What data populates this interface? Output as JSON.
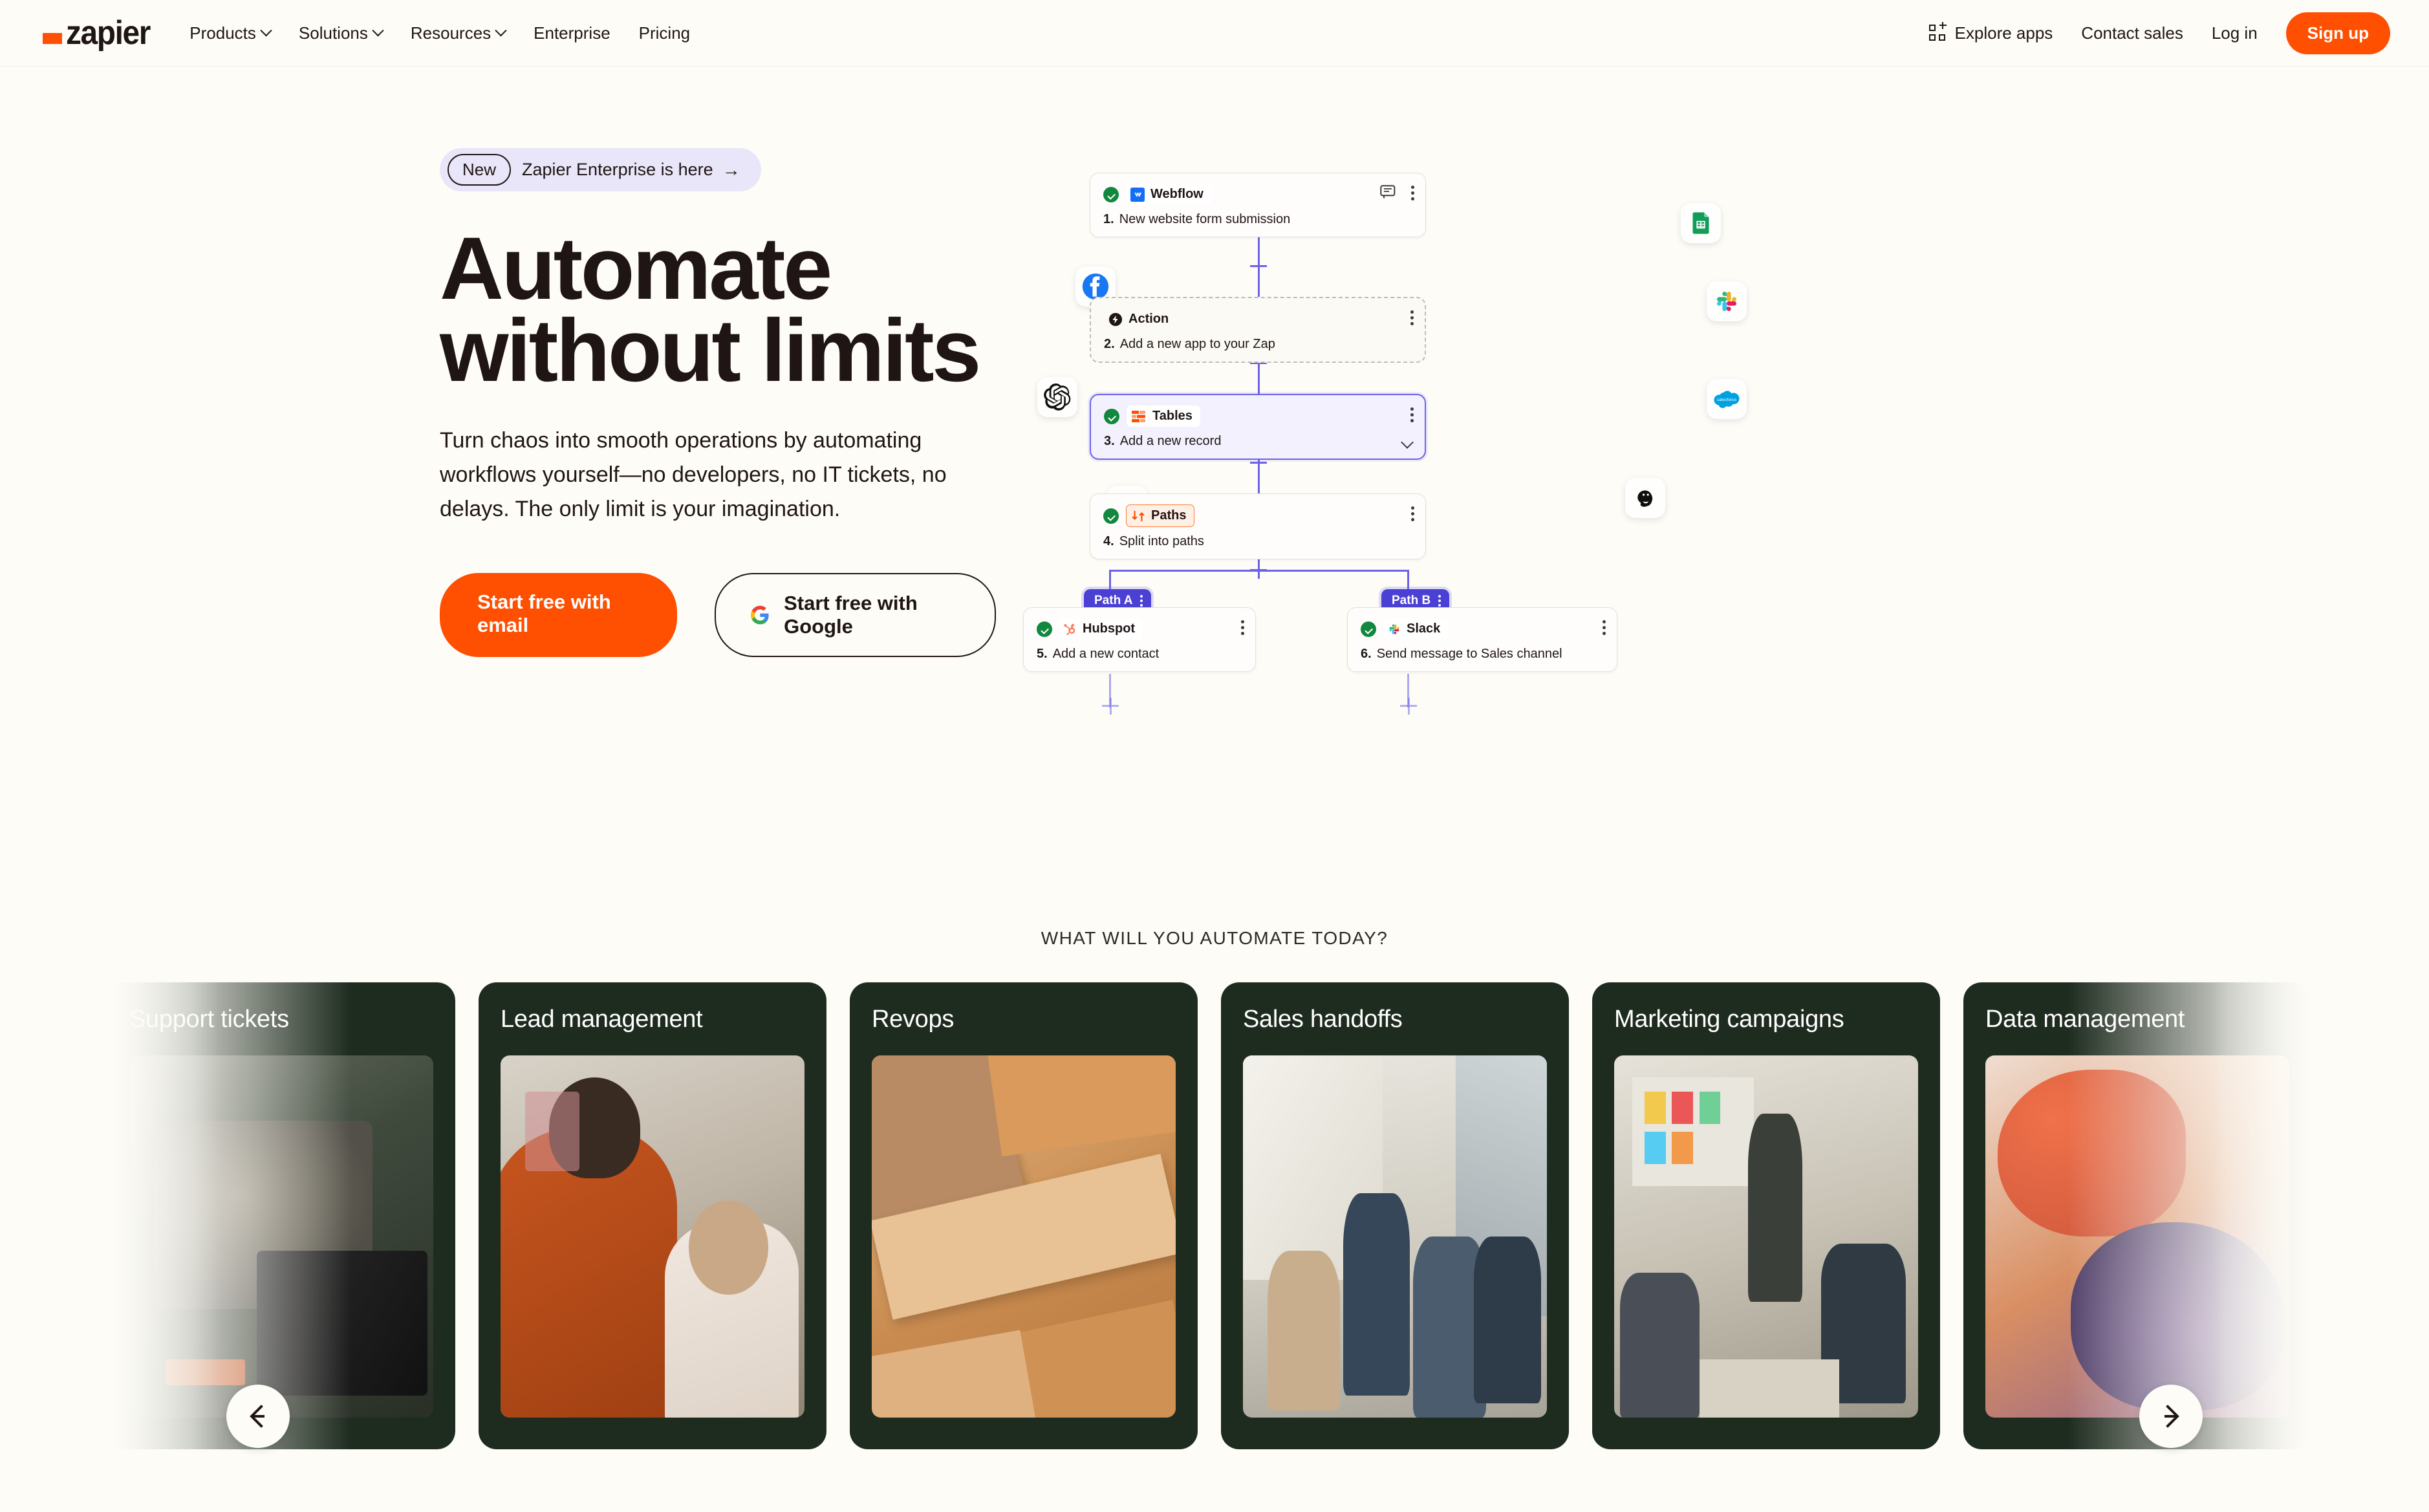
{
  "brand": {
    "name": "zapier",
    "accent": "#FF4F00",
    "background": "#FDFCF7"
  },
  "header": {
    "nav_left": [
      {
        "label": "Products",
        "has_chevron": true
      },
      {
        "label": "Solutions",
        "has_chevron": true
      },
      {
        "label": "Resources",
        "has_chevron": true
      },
      {
        "label": "Enterprise",
        "has_chevron": false
      },
      {
        "label": "Pricing",
        "has_chevron": false
      }
    ],
    "explore_apps": "Explore apps",
    "contact_sales": "Contact sales",
    "log_in": "Log in",
    "sign_up": "Sign up"
  },
  "hero": {
    "pill": {
      "badge": "New",
      "text": "Zapier Enterprise is here",
      "arrow": "→"
    },
    "title": "Automate without limits",
    "subtitle": "Turn chaos into smooth operations by automating workflows yourself—no developers, no IT tickets, no delays. The only limit is your imagination.",
    "cta_primary": "Start free with email",
    "cta_google": "Start free with Google"
  },
  "workflow": {
    "steps": [
      {
        "number": "1.",
        "app": "Webflow",
        "title": "New website form submission",
        "state": "done",
        "has_comment": true
      },
      {
        "number": "2.",
        "app": "Action",
        "title": "Add a new app to your Zap",
        "state": "placeholder",
        "has_comment": false
      },
      {
        "number": "3.",
        "app": "Tables",
        "title": "Add a new record",
        "state": "selected",
        "has_comment": false
      },
      {
        "number": "4.",
        "app": "Paths",
        "title": "Split into paths",
        "state": "done",
        "has_comment": false
      }
    ],
    "branches": [
      {
        "tab": "Path A",
        "number": "5.",
        "app": "Hubspot",
        "title": "Add a new contact"
      },
      {
        "tab": "Path B",
        "number": "6.",
        "app": "Slack",
        "title": "Send message to Sales channel"
      }
    ],
    "floating_apps": [
      "Facebook",
      "OpenAI",
      "Notion",
      "Google Sheets",
      "Slack",
      "Salesforce",
      "Mailchimp"
    ],
    "connector_color": "#6C62E8"
  },
  "carousel": {
    "heading": "WHAT WILL YOU AUTOMATE TODAY?",
    "cards": [
      {
        "title": "Support tickets",
        "clipped": "left"
      },
      {
        "title": "Lead management",
        "clipped": "none"
      },
      {
        "title": "Revops",
        "clipped": "none"
      },
      {
        "title": "Sales handoffs",
        "clipped": "none"
      },
      {
        "title": "Marketing campaigns",
        "clipped": "none"
      },
      {
        "title": "Data management",
        "clipped": "right"
      }
    ],
    "prev_label": "←",
    "next_label": "→"
  }
}
